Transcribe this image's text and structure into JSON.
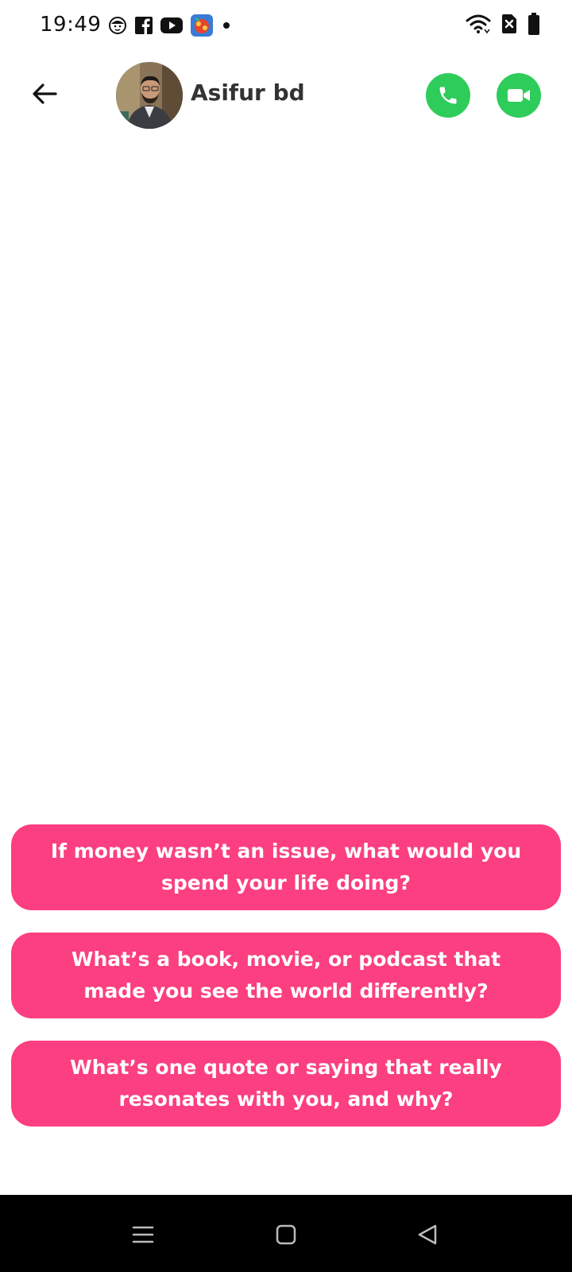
{
  "status_bar": {
    "time": "19:49",
    "left_icons": [
      "face-icon",
      "facebook-icon",
      "youtube-icon",
      "game-app-icon",
      "dot-icon"
    ],
    "right_icons": [
      "wifi-icon",
      "no-sim-icon",
      "battery-icon"
    ]
  },
  "header": {
    "back_icon": "arrow-left-icon",
    "contact_name": "Asifur bd",
    "avatar_alt": "Asifur bd",
    "call_icon": "phone-icon",
    "video_icon": "video-camera-icon",
    "accent_color": "#2ecc5a"
  },
  "suggestions": {
    "color": "#fc3f80",
    "items": [
      {
        "text": "If money wasn’t an issue, what would you spend your life doing?"
      },
      {
        "text": "What’s a book, movie, or podcast that made you see the world differently?"
      },
      {
        "text": "What’s one quote or saying that really resonates with you, and why?"
      }
    ]
  },
  "nav_bar": {
    "icons": [
      "recent-apps-icon",
      "home-icon",
      "back-triangle-icon"
    ]
  }
}
